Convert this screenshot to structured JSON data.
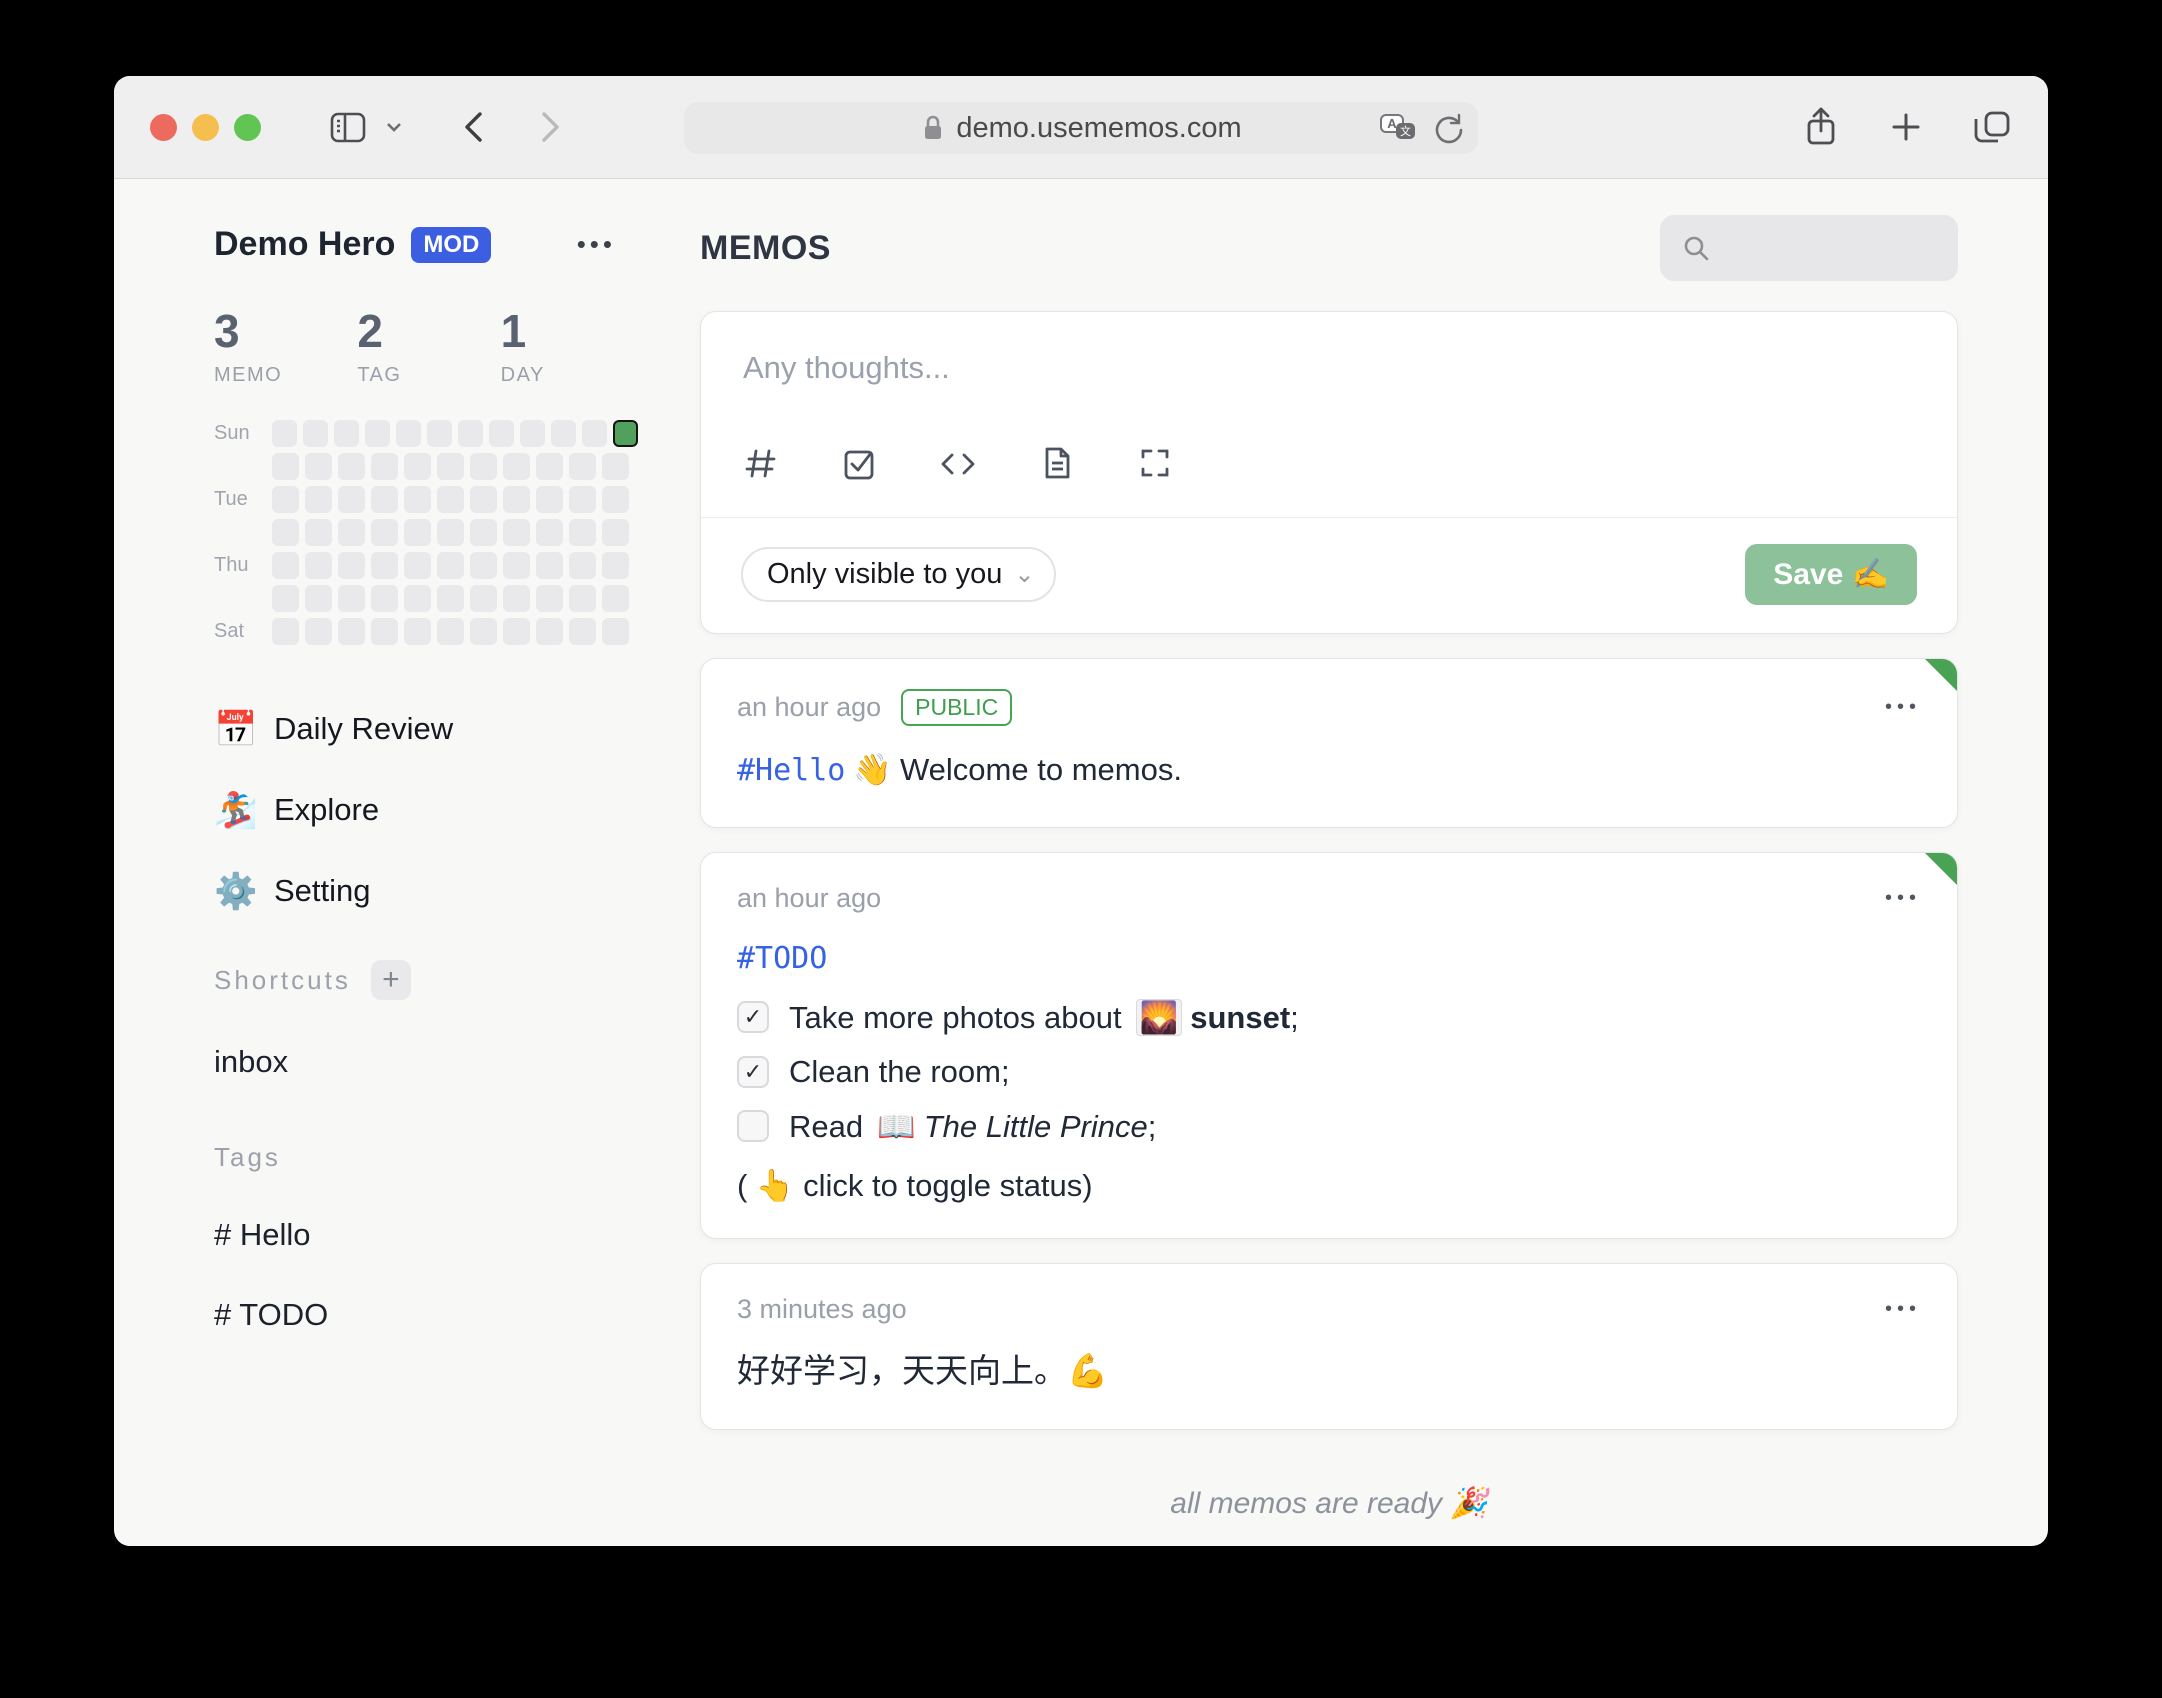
{
  "colors": {
    "accent_blue": "#3b5fe0",
    "save_green": "#8cc19a",
    "public_green": "#3f9e4d",
    "ribbon_green": "#4aa355",
    "heatmap_active_green": "#52a05e",
    "traffic_red": "#ed6a5e",
    "traffic_yellow": "#f5bf4f",
    "traffic_green": "#61c554"
  },
  "browser": {
    "url": "demo.usememos.com"
  },
  "icons": {
    "chevron_down": "⌄",
    "plus": "+",
    "dots": "•••",
    "check": "✓"
  },
  "sidebar": {
    "user": {
      "name": "Demo Hero",
      "badge": "MOD",
      "menu": "•••"
    },
    "stats": [
      {
        "value": "3",
        "label": "MEMO"
      },
      {
        "value": "2",
        "label": "TAG"
      },
      {
        "value": "1",
        "label": "DAY"
      }
    ],
    "heatmap": {
      "rows": [
        {
          "label": "Sun",
          "cells": 12,
          "active_index": 11
        },
        {
          "label": "",
          "cells": 11,
          "active_index": -1
        },
        {
          "label": "Tue",
          "cells": 11,
          "active_index": -1
        },
        {
          "label": "",
          "cells": 11,
          "active_index": -1
        },
        {
          "label": "Thu",
          "cells": 11,
          "active_index": -1
        },
        {
          "label": "",
          "cells": 11,
          "active_index": -1
        },
        {
          "label": "Sat",
          "cells": 11,
          "active_index": -1
        }
      ]
    },
    "menu": [
      {
        "icon": "📅",
        "label": "Daily Review"
      },
      {
        "icon": "🏂",
        "label": "Explore"
      },
      {
        "icon": "⚙️",
        "label": "Setting"
      }
    ],
    "shortcuts": {
      "title": "Shortcuts",
      "add": "+",
      "items": [
        "inbox"
      ]
    },
    "tags": {
      "title": "Tags",
      "items": [
        "# Hello",
        "# TODO"
      ]
    }
  },
  "main": {
    "title": "MEMOS",
    "editor": {
      "placeholder": "Any thoughts...",
      "visibility": "Only visible to you",
      "save_label": "Save ✍️"
    },
    "memos": [
      {
        "time": "an hour ago",
        "visibility_badge": "PUBLIC",
        "menu": "•••",
        "tag": "#Hello",
        "emoji": "👋",
        "text": "Welcome to memos."
      },
      {
        "time": "an hour ago",
        "menu": "•••",
        "tag": "#TODO",
        "items": [
          {
            "mark": "✓",
            "pre": "Take more photos about",
            "emoji": "🌄",
            "bold": "sunset",
            "post": ";"
          },
          {
            "mark": "✓",
            "pre": "Clean the room;"
          },
          {
            "mark": "",
            "pre": "Read",
            "emoji": "📖",
            "italic": "The Little Prince",
            "post": ";"
          }
        ],
        "note": "( 👆  click to toggle status)"
      },
      {
        "time": "3 minutes ago",
        "menu": "•••",
        "text": "好好学习，天天向上。💪"
      }
    ],
    "footer": "all memos are ready 🎉"
  }
}
